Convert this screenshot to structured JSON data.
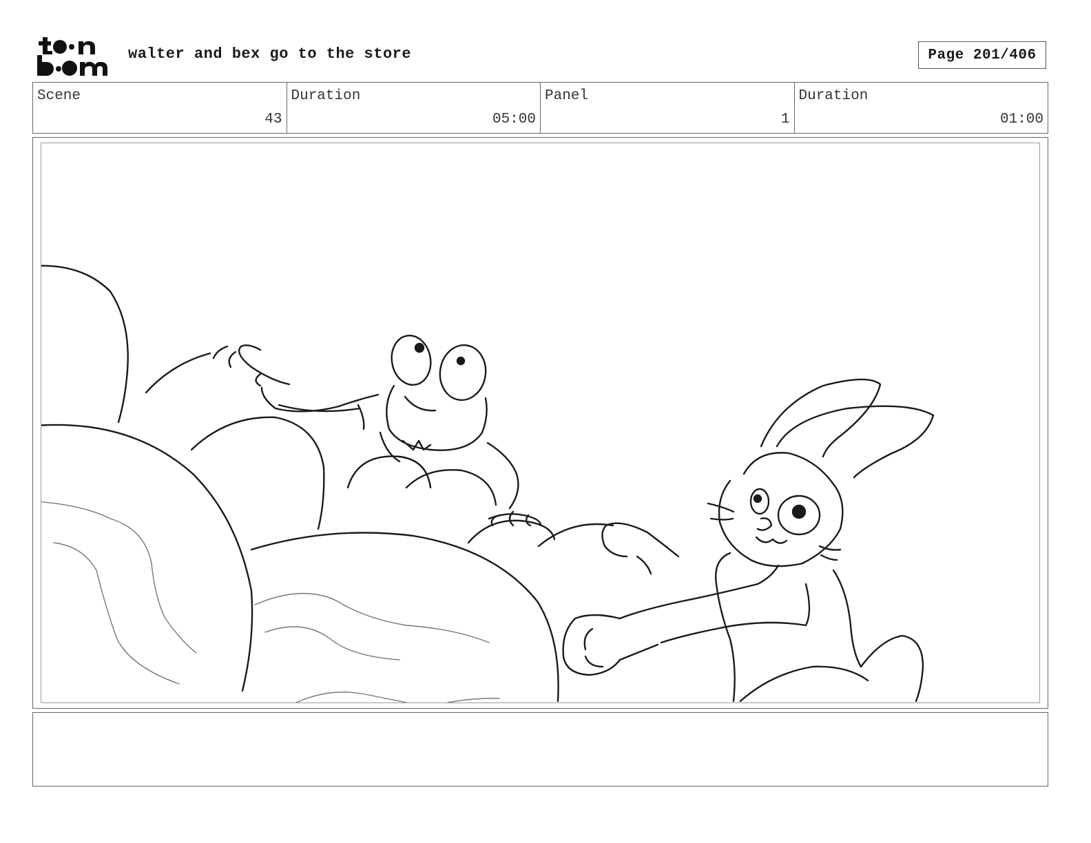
{
  "header": {
    "logo_icon": "toon-boom-logo",
    "title": "walter and bex go to the store",
    "page_label": "Page 201/406"
  },
  "info": [
    {
      "label": "Scene",
      "value": "43"
    },
    {
      "label": "Duration",
      "value": "05:00"
    },
    {
      "label": "Panel",
      "value": "1"
    },
    {
      "label": "Duration",
      "value": "01:00"
    }
  ],
  "panel": {
    "sketch_icon": "frog-and-rabbit-sketch"
  },
  "notes": {
    "text": ""
  }
}
